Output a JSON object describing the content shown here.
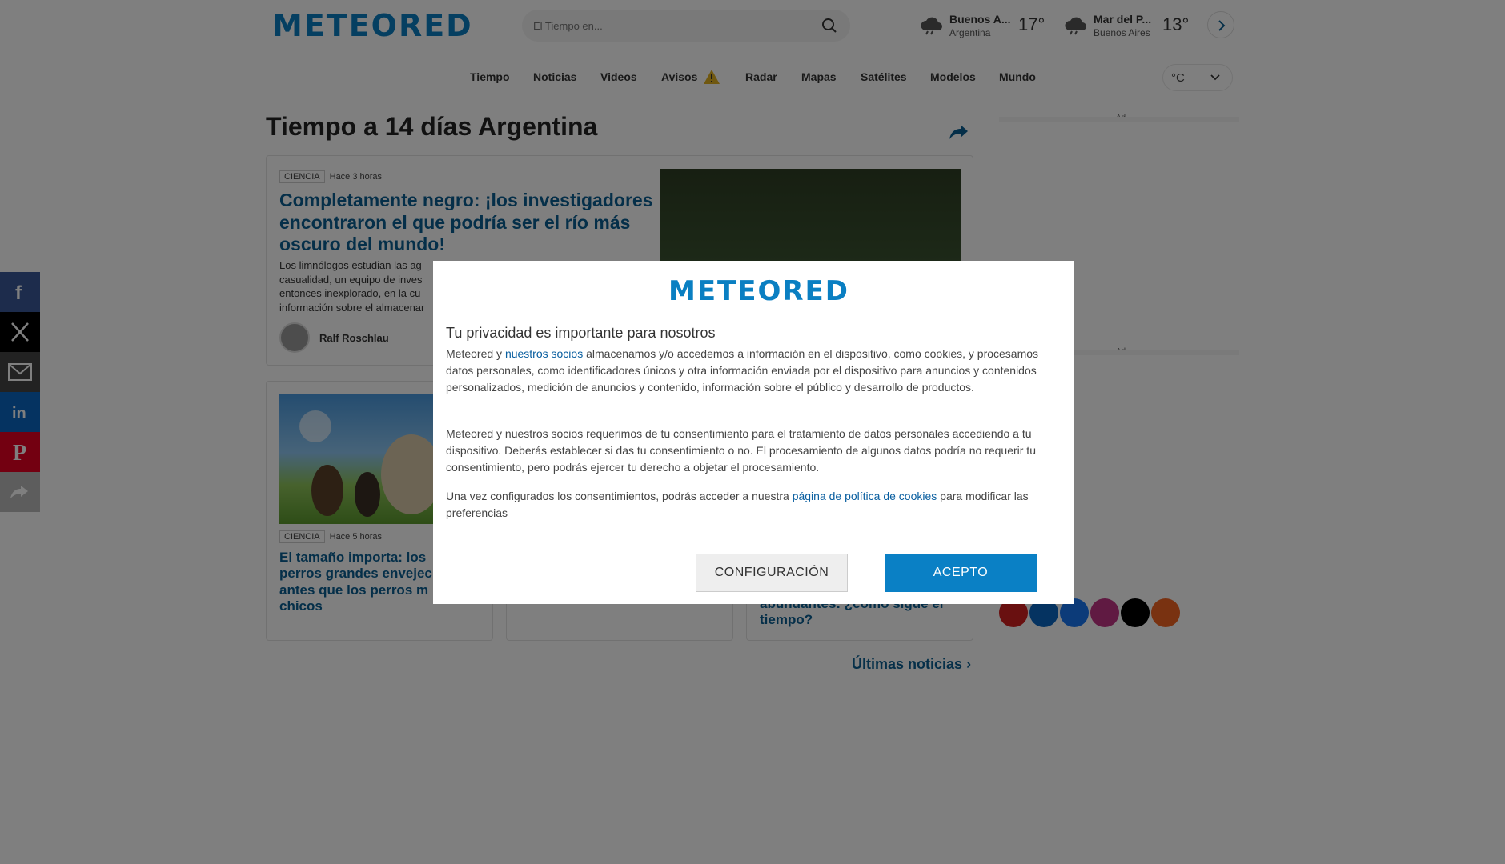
{
  "header": {
    "logo": "METEORED",
    "search_placeholder": "El Tiempo en...",
    "weather": [
      {
        "city": "Buenos A...",
        "region": "Argentina",
        "temp": "17°"
      },
      {
        "city": "Mar del P...",
        "region": "Buenos Aires",
        "temp": "13°"
      }
    ],
    "unit": "°C"
  },
  "nav": [
    "Tiempo",
    "Noticias",
    "Videos",
    "Avisos",
    "Radar",
    "Mapas",
    "Satélites",
    "Modelos",
    "Mundo"
  ],
  "page_title": "Tiempo a 14 días Argentina",
  "articles": [
    {
      "category": "CIENCIA",
      "time": "Hace 3 horas",
      "title": "Completamente negro: ¡los investigadores encontraron el que podría ser el río más oscuro del mundo!",
      "snippet_lines": [
        "Los limnólogos estudian las ag",
        "casualidad, un equipo de inves",
        "entonces inexplorado, en la cu",
        "información sobre el almacenar"
      ],
      "author": "Ralf Roschlau"
    },
    {
      "category": "CIENCIA",
      "time": "Hace 5 horas",
      "title_lines": [
        "El tamaño importa: los",
        "perros grandes envejec",
        "antes que los perros m",
        "chicos"
      ]
    },
    {
      "title_lines": [
        "abundantes: ¿cómo sigue el",
        "tiempo?"
      ]
    }
  ],
  "ultimas_noticias": "Últimas noticias",
  "ad_label": "Ad",
  "modal": {
    "logo": "METEORED",
    "heading": "Tu privacidad es importante para nosotros",
    "p1_before": "Meteored y ",
    "p1_link": "nuestros socios",
    "p1_after": " almacenamos y/o accedemos a información en el dispositivo, como cookies, y procesamos datos personales, como identificadores únicos y otra información enviada por el dispositivo para anuncios y contenidos personalizados, medición de anuncios y contenido, información sobre el público y desarrollo de productos.",
    "p2": "Meteored y nuestros socios requerimos de tu consentimiento para el tratamiento de datos personales accediendo a tu dispositivo. Deberás establecer si das tu consentimiento o no. El procesamiento de algunos datos podría no requerir tu consentimiento, pero podrás ejercer tu derecho a objetar el procesamiento.",
    "p3_before": "Una vez configurados los consentimientos, podrás acceder a nuestra ",
    "p3_link": "página de política de cookies",
    "p3_after": " para modificar las preferencias",
    "btn_config": "CONFIGURACIÓN",
    "btn_accept": "ACEPTO"
  },
  "colors": {
    "brand": "#0a7fc2",
    "accept": "#0a80c5",
    "link": "#0a5f92"
  }
}
